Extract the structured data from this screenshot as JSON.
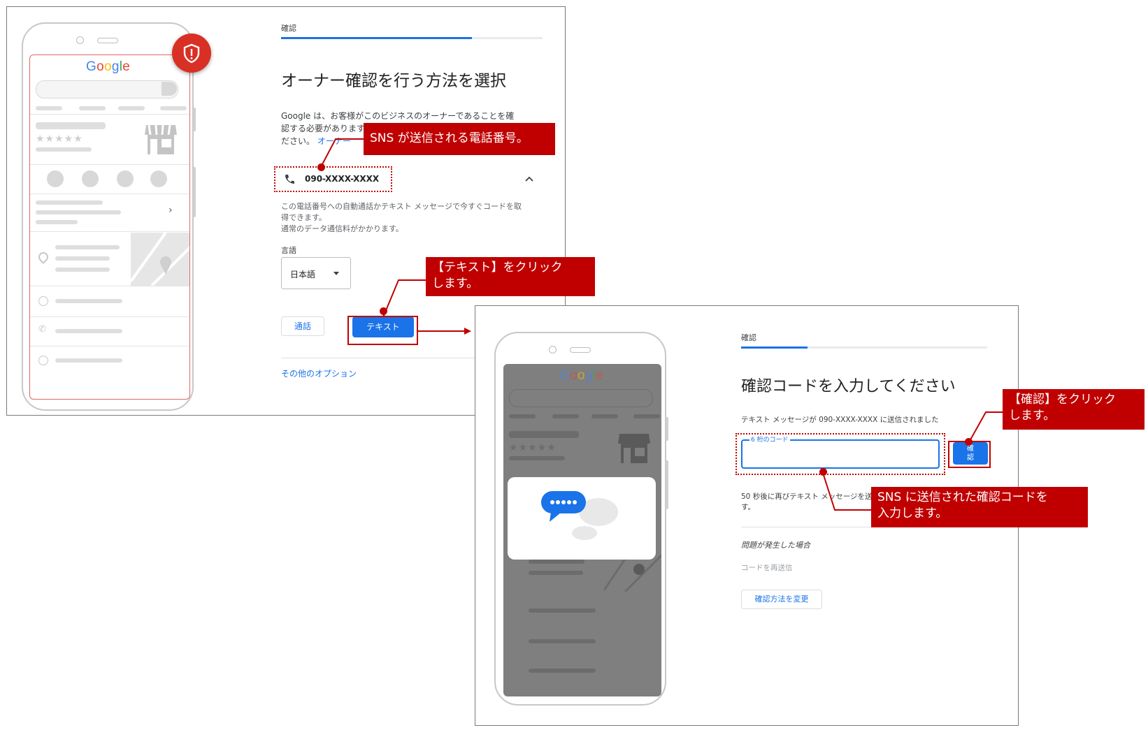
{
  "brand_logo": "Google",
  "panel1": {
    "step_label": "確認",
    "progress_fraction": 0.73,
    "heading": "オーナー確認を行う方法を選択",
    "description_line1": "Google は、お客様がこのビジネスのオーナーであることを確",
    "description_line2": "認する必要があります。",
    "description_line3": "ださい。",
    "description_link": "オーナー",
    "phone_number": "090-XXXX-XXXX",
    "note_line1": "この電話番号への自動通話かテキスト メッセージで今すぐコードを取",
    "note_line2": "得できます。",
    "note_line3": "通常のデータ通信料がかかります。",
    "language_label": "言語",
    "language_value": "日本語",
    "call_button": "通話",
    "text_button": "テキスト",
    "other_options_link": "その他のオプション",
    "shield_icon": "shield-alert-icon"
  },
  "panel2": {
    "step_label": "確認",
    "progress_fraction": 0.27,
    "heading": "確認コードを入力してください",
    "sent_info": "テキスト メッセージが 090-XXXX-XXXX に送信されました",
    "code_field_label": "6 桁のコード",
    "confirm_button": "確認",
    "resend_line1": "50 秒後に再びテキスト メッセージを送信できま",
    "resend_line2": "す。",
    "problem_heading": "問題が発生した場合",
    "resend_code": "コードを再送信",
    "change_method_button": "確認方法を変更",
    "chat_icon": "chat-bubbles-icon"
  },
  "callouts": {
    "phone_number": "SNS が送信される電話番号。",
    "text_click_line1": "【テキスト】をクリック",
    "text_click_line2": "します。",
    "confirm_click_line1": "【確認】をクリック",
    "confirm_click_line2": "します。",
    "enter_code_line1": "SNS に送信された確認コードを",
    "enter_code_line2": "入力します。"
  },
  "colors": {
    "accent_blue": "#1a73e8",
    "callout_red": "#c00000",
    "shield_red": "#d93025"
  }
}
